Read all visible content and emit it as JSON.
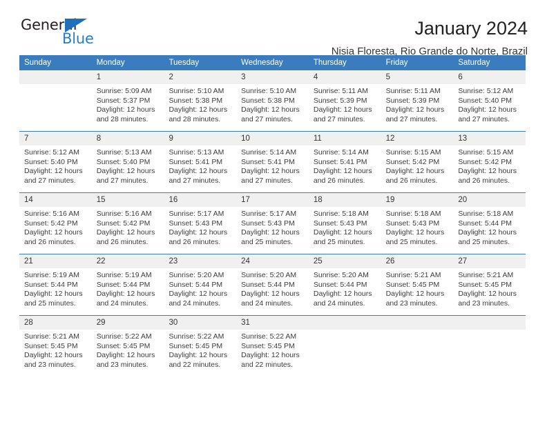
{
  "brand": {
    "name_part1": "General",
    "name_part2": "Blue",
    "accent_color": "#2b7cc4",
    "triangle_color": "#1c71b8"
  },
  "header": {
    "title": "January 2024",
    "subtitle": "Nisia Floresta, Rio Grande do Norte, Brazil"
  },
  "calendar": {
    "header_bg": "#3a7cbe",
    "day_band_bg": "#f0f0f0",
    "weekdays": [
      "Sunday",
      "Monday",
      "Tuesday",
      "Wednesday",
      "Thursday",
      "Friday",
      "Saturday"
    ],
    "weeks": [
      [
        {
          "day": "",
          "empty": true
        },
        {
          "day": "1",
          "sunrise": "Sunrise: 5:09 AM",
          "sunset": "Sunset: 5:37 PM",
          "daylight1": "Daylight: 12 hours",
          "daylight2": "and 28 minutes."
        },
        {
          "day": "2",
          "sunrise": "Sunrise: 5:10 AM",
          "sunset": "Sunset: 5:38 PM",
          "daylight1": "Daylight: 12 hours",
          "daylight2": "and 28 minutes."
        },
        {
          "day": "3",
          "sunrise": "Sunrise: 5:10 AM",
          "sunset": "Sunset: 5:38 PM",
          "daylight1": "Daylight: 12 hours",
          "daylight2": "and 27 minutes."
        },
        {
          "day": "4",
          "sunrise": "Sunrise: 5:11 AM",
          "sunset": "Sunset: 5:39 PM",
          "daylight1": "Daylight: 12 hours",
          "daylight2": "and 27 minutes."
        },
        {
          "day": "5",
          "sunrise": "Sunrise: 5:11 AM",
          "sunset": "Sunset: 5:39 PM",
          "daylight1": "Daylight: 12 hours",
          "daylight2": "and 27 minutes."
        },
        {
          "day": "6",
          "sunrise": "Sunrise: 5:12 AM",
          "sunset": "Sunset: 5:40 PM",
          "daylight1": "Daylight: 12 hours",
          "daylight2": "and 27 minutes."
        }
      ],
      [
        {
          "day": "7",
          "sunrise": "Sunrise: 5:12 AM",
          "sunset": "Sunset: 5:40 PM",
          "daylight1": "Daylight: 12 hours",
          "daylight2": "and 27 minutes."
        },
        {
          "day": "8",
          "sunrise": "Sunrise: 5:13 AM",
          "sunset": "Sunset: 5:40 PM",
          "daylight1": "Daylight: 12 hours",
          "daylight2": "and 27 minutes."
        },
        {
          "day": "9",
          "sunrise": "Sunrise: 5:13 AM",
          "sunset": "Sunset: 5:41 PM",
          "daylight1": "Daylight: 12 hours",
          "daylight2": "and 27 minutes."
        },
        {
          "day": "10",
          "sunrise": "Sunrise: 5:14 AM",
          "sunset": "Sunset: 5:41 PM",
          "daylight1": "Daylight: 12 hours",
          "daylight2": "and 27 minutes."
        },
        {
          "day": "11",
          "sunrise": "Sunrise: 5:14 AM",
          "sunset": "Sunset: 5:41 PM",
          "daylight1": "Daylight: 12 hours",
          "daylight2": "and 26 minutes."
        },
        {
          "day": "12",
          "sunrise": "Sunrise: 5:15 AM",
          "sunset": "Sunset: 5:42 PM",
          "daylight1": "Daylight: 12 hours",
          "daylight2": "and 26 minutes."
        },
        {
          "day": "13",
          "sunrise": "Sunrise: 5:15 AM",
          "sunset": "Sunset: 5:42 PM",
          "daylight1": "Daylight: 12 hours",
          "daylight2": "and 26 minutes."
        }
      ],
      [
        {
          "day": "14",
          "sunrise": "Sunrise: 5:16 AM",
          "sunset": "Sunset: 5:42 PM",
          "daylight1": "Daylight: 12 hours",
          "daylight2": "and 26 minutes."
        },
        {
          "day": "15",
          "sunrise": "Sunrise: 5:16 AM",
          "sunset": "Sunset: 5:42 PM",
          "daylight1": "Daylight: 12 hours",
          "daylight2": "and 26 minutes."
        },
        {
          "day": "16",
          "sunrise": "Sunrise: 5:17 AM",
          "sunset": "Sunset: 5:43 PM",
          "daylight1": "Daylight: 12 hours",
          "daylight2": "and 26 minutes."
        },
        {
          "day": "17",
          "sunrise": "Sunrise: 5:17 AM",
          "sunset": "Sunset: 5:43 PM",
          "daylight1": "Daylight: 12 hours",
          "daylight2": "and 25 minutes."
        },
        {
          "day": "18",
          "sunrise": "Sunrise: 5:18 AM",
          "sunset": "Sunset: 5:43 PM",
          "daylight1": "Daylight: 12 hours",
          "daylight2": "and 25 minutes."
        },
        {
          "day": "19",
          "sunrise": "Sunrise: 5:18 AM",
          "sunset": "Sunset: 5:43 PM",
          "daylight1": "Daylight: 12 hours",
          "daylight2": "and 25 minutes."
        },
        {
          "day": "20",
          "sunrise": "Sunrise: 5:18 AM",
          "sunset": "Sunset: 5:44 PM",
          "daylight1": "Daylight: 12 hours",
          "daylight2": "and 25 minutes."
        }
      ],
      [
        {
          "day": "21",
          "sunrise": "Sunrise: 5:19 AM",
          "sunset": "Sunset: 5:44 PM",
          "daylight1": "Daylight: 12 hours",
          "daylight2": "and 25 minutes."
        },
        {
          "day": "22",
          "sunrise": "Sunrise: 5:19 AM",
          "sunset": "Sunset: 5:44 PM",
          "daylight1": "Daylight: 12 hours",
          "daylight2": "and 24 minutes."
        },
        {
          "day": "23",
          "sunrise": "Sunrise: 5:20 AM",
          "sunset": "Sunset: 5:44 PM",
          "daylight1": "Daylight: 12 hours",
          "daylight2": "and 24 minutes."
        },
        {
          "day": "24",
          "sunrise": "Sunrise: 5:20 AM",
          "sunset": "Sunset: 5:44 PM",
          "daylight1": "Daylight: 12 hours",
          "daylight2": "and 24 minutes."
        },
        {
          "day": "25",
          "sunrise": "Sunrise: 5:20 AM",
          "sunset": "Sunset: 5:44 PM",
          "daylight1": "Daylight: 12 hours",
          "daylight2": "and 24 minutes."
        },
        {
          "day": "26",
          "sunrise": "Sunrise: 5:21 AM",
          "sunset": "Sunset: 5:45 PM",
          "daylight1": "Daylight: 12 hours",
          "daylight2": "and 23 minutes."
        },
        {
          "day": "27",
          "sunrise": "Sunrise: 5:21 AM",
          "sunset": "Sunset: 5:45 PM",
          "daylight1": "Daylight: 12 hours",
          "daylight2": "and 23 minutes."
        }
      ],
      [
        {
          "day": "28",
          "sunrise": "Sunrise: 5:21 AM",
          "sunset": "Sunset: 5:45 PM",
          "daylight1": "Daylight: 12 hours",
          "daylight2": "and 23 minutes."
        },
        {
          "day": "29",
          "sunrise": "Sunrise: 5:22 AM",
          "sunset": "Sunset: 5:45 PM",
          "daylight1": "Daylight: 12 hours",
          "daylight2": "and 23 minutes."
        },
        {
          "day": "30",
          "sunrise": "Sunrise: 5:22 AM",
          "sunset": "Sunset: 5:45 PM",
          "daylight1": "Daylight: 12 hours",
          "daylight2": "and 22 minutes."
        },
        {
          "day": "31",
          "sunrise": "Sunrise: 5:22 AM",
          "sunset": "Sunset: 5:45 PM",
          "daylight1": "Daylight: 12 hours",
          "daylight2": "and 22 minutes."
        },
        {
          "day": "",
          "empty": true
        },
        {
          "day": "",
          "empty": true
        },
        {
          "day": "",
          "empty": true
        }
      ]
    ]
  }
}
